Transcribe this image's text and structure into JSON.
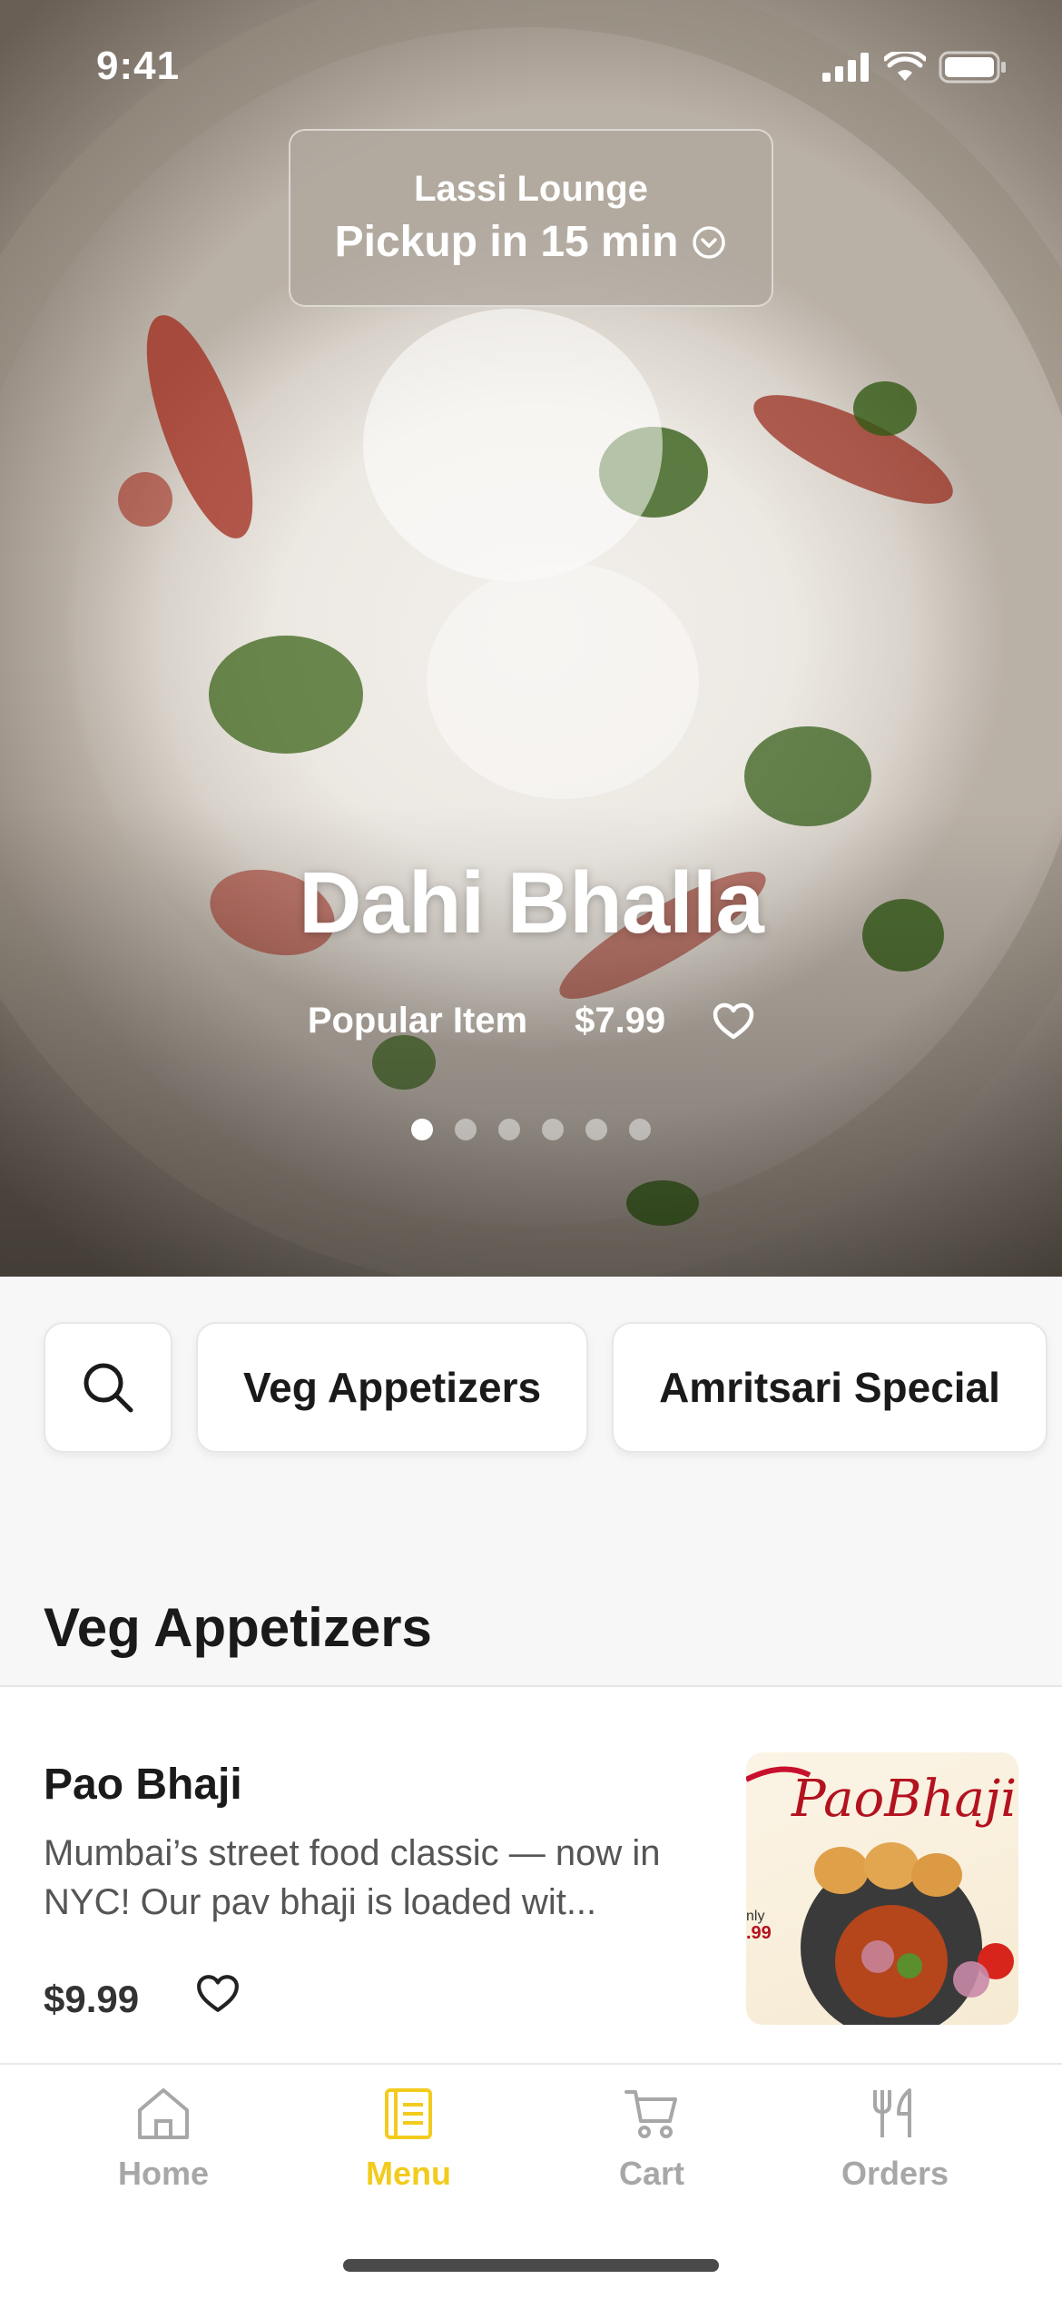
{
  "status_bar": {
    "time": "9:41"
  },
  "pickup": {
    "restaurant": "Lassi Lounge",
    "time": "Pickup in 15 min"
  },
  "hero": {
    "title": "Dahi Bhalla",
    "tag": "Popular Item",
    "price": "$7.99",
    "slides_total": 6,
    "active_slide": 1
  },
  "categories": {
    "items": [
      "Veg Appetizers",
      "Amritsari Special"
    ]
  },
  "section": {
    "title": "Veg Appetizers"
  },
  "menu_item": {
    "name": "Pao Bhaji",
    "description": "Mumbai’s street food classic — now in NYC! Our pav bhaji is loaded wit...",
    "price": "$9.99",
    "image_text": "PaoBhaji",
    "image_offer_top": "nly",
    "image_offer_price": ".99"
  },
  "tabs": [
    {
      "label": "Home",
      "icon": "home-icon",
      "active": false
    },
    {
      "label": "Menu",
      "icon": "menu-icon",
      "active": true
    },
    {
      "label": "Cart",
      "icon": "cart-icon",
      "active": false
    },
    {
      "label": "Orders",
      "icon": "utensils-icon",
      "active": false
    }
  ],
  "colors": {
    "accent": "#f2cb1d",
    "inactive": "#a7a7a7"
  }
}
